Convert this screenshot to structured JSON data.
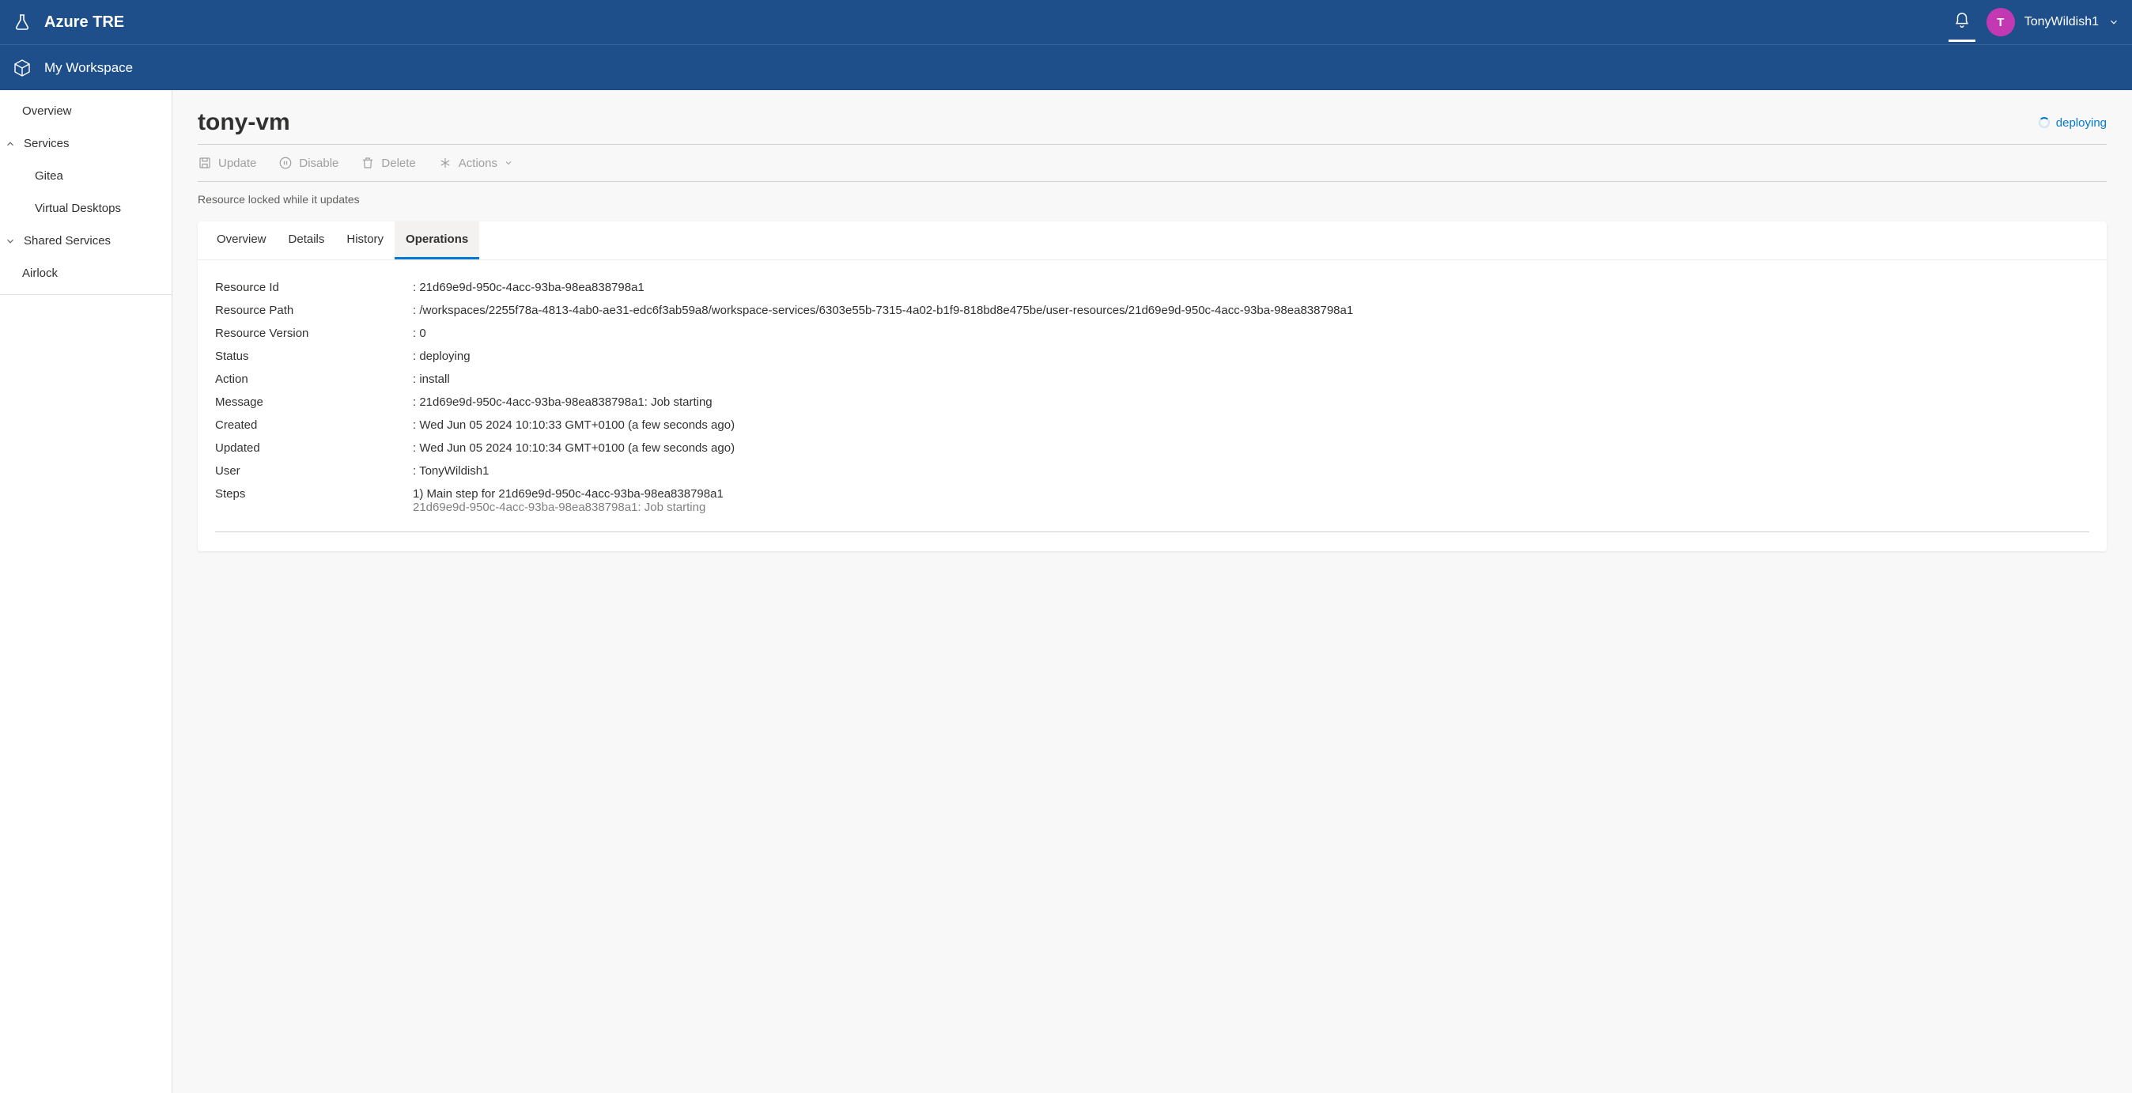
{
  "header": {
    "product": "Azure TRE",
    "user": "TonyWildish1",
    "avatar_initial": "T",
    "breadcrumb": "My Workspace"
  },
  "sidebar": {
    "overview": "Overview",
    "services_label": "Services",
    "services_items": [
      "Gitea",
      "Virtual Desktops"
    ],
    "shared_label": "Shared Services",
    "airlock": "Airlock"
  },
  "main": {
    "title": "tony-vm",
    "status_chip": "deploying",
    "toolbar": {
      "update": "Update",
      "disable": "Disable",
      "delete": "Delete",
      "actions": "Actions"
    },
    "lock_message": "Resource locked while it updates",
    "tabs": [
      "Overview",
      "Details",
      "History",
      "Operations"
    ],
    "active_tab": "Operations",
    "operation": {
      "resource_id_label": "Resource Id",
      "resource_id": "21d69e9d-950c-4acc-93ba-98ea838798a1",
      "resource_path_label": "Resource Path",
      "resource_path": "/workspaces/2255f78a-4813-4ab0-ae31-edc6f3ab59a8/workspace-services/6303e55b-7315-4a02-b1f9-818bd8e475be/user-resources/21d69e9d-950c-4acc-93ba-98ea838798a1",
      "resource_version_label": "Resource Version",
      "resource_version": "0",
      "status_label": "Status",
      "status": "deploying",
      "action_label": "Action",
      "action": "install",
      "message_label": "Message",
      "message": "21d69e9d-950c-4acc-93ba-98ea838798a1: Job starting",
      "created_label": "Created",
      "created": "Wed Jun 05 2024 10:10:33 GMT+0100 (a few seconds ago)",
      "updated_label": "Updated",
      "updated": "Wed Jun 05 2024 10:10:34 GMT+0100 (a few seconds ago)",
      "user_label": "User",
      "user": "TonyWildish1",
      "steps_label": "Steps",
      "steps_main": "1) Main step for 21d69e9d-950c-4acc-93ba-98ea838798a1",
      "steps_sub": "21d69e9d-950c-4acc-93ba-98ea838798a1: Job starting"
    }
  }
}
